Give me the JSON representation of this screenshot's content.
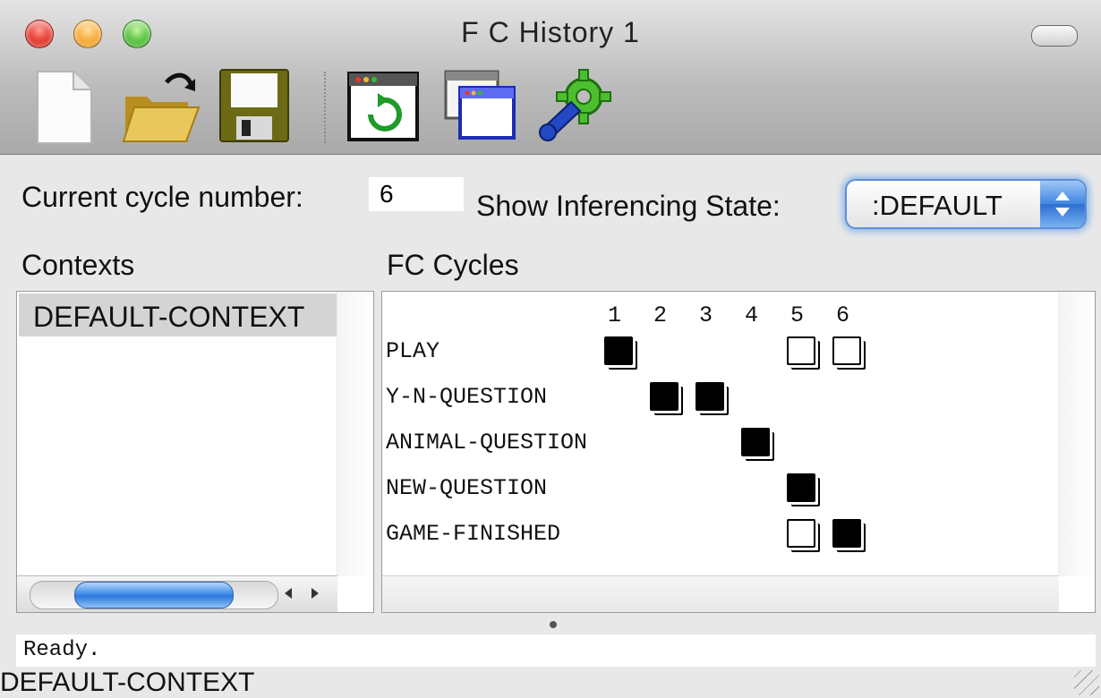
{
  "window": {
    "title": "F C History 1"
  },
  "toolbar": {
    "buttons": [
      "new-document-icon",
      "open-folder-icon",
      "save-disk-icon",
      "refresh-window-icon",
      "windows-icon",
      "settings-gear-wrench-icon"
    ]
  },
  "controls": {
    "cycle_label": "Current cycle number:",
    "cycle_value": "6",
    "state_label": "Show Inferencing State:",
    "state_value": ":DEFAULT"
  },
  "contexts": {
    "header": "Contexts",
    "items": [
      "DEFAULT-CONTEXT"
    ]
  },
  "fc_cycles": {
    "header": "FC Cycles",
    "columns": [
      "1",
      "2",
      "3",
      "4",
      "5",
      "6"
    ],
    "rows": [
      {
        "label": "PLAY",
        "cells": {
          "1": "filled",
          "5": "empty",
          "6": "empty"
        }
      },
      {
        "label": "Y-N-QUESTION",
        "cells": {
          "2": "filled",
          "3": "filled"
        }
      },
      {
        "label": "ANIMAL-QUESTION",
        "cells": {
          "4": "filled"
        }
      },
      {
        "label": "NEW-QUESTION",
        "cells": {
          "5": "filled"
        }
      },
      {
        "label": "GAME-FINISHED",
        "cells": {
          "5": "empty",
          "6": "filled"
        }
      }
    ]
  },
  "status": {
    "text": "Ready.",
    "context": "DEFAULT-CONTEXT"
  },
  "colors": {
    "selection": "#d4d4d4",
    "focus_ring": "#5d8fd6"
  }
}
